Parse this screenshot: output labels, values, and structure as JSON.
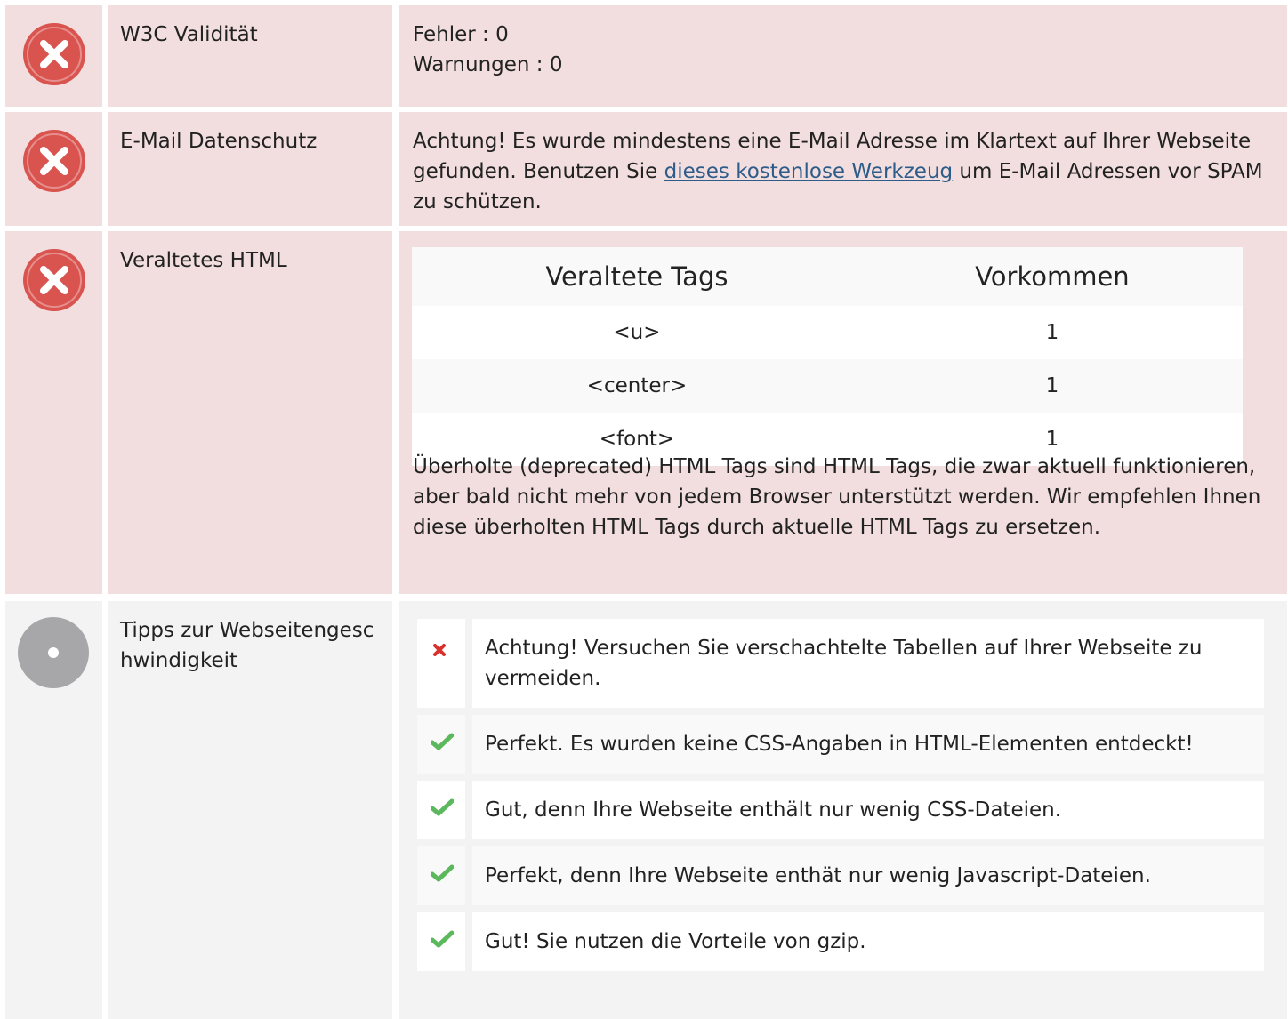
{
  "colors": {
    "error_bg": "#f2dede",
    "neutral_bg": "#f3f3f3",
    "error_icon": "#d9534f",
    "neutral_icon": "#a7a7aa",
    "check_green": "#5cb85c",
    "cross_red": "#d9302c",
    "link": "#2e5c8a"
  },
  "rows": {
    "w3c": {
      "status": "error",
      "icon": "error-circle-icon",
      "label": "W3C Validität",
      "errors": "Fehler : 0",
      "warnings": "Warnungen : 0"
    },
    "email": {
      "status": "error",
      "icon": "error-circle-icon",
      "label": "E-Mail Datenschutz",
      "text_before": "Achtung! Es wurde mindestens eine E-Mail Adresse im Klartext auf Ihrer Webseite gefunden. Benutzen Sie ",
      "link": "dieses kostenlose Werkzeug",
      "text_after": " um E-Mail Adressen vor SPAM zu schützen."
    },
    "deprecated": {
      "status": "error",
      "icon": "error-circle-icon",
      "label": "Veraltetes HTML",
      "headers": [
        "Veraltete Tags",
        "Vorkommen"
      ],
      "tags": [
        {
          "tag": "<u>",
          "count": "1"
        },
        {
          "tag": "<center>",
          "count": "1"
        },
        {
          "tag": "<font>",
          "count": "1"
        }
      ],
      "description": "Überholte (deprecated) HTML Tags sind HTML Tags, die zwar aktuell funktionieren, aber bald nicht mehr von jedem Browser unterstützt werden. Wir empfehlen Ihnen diese überholten HTML Tags durch aktuelle HTML Tags zu ersetzen."
    },
    "speed": {
      "status": "neutral",
      "icon": "neutral-circle-icon",
      "label": "Tipps zur Webseitengeschwindigkeit",
      "tips": [
        {
          "status": "fail",
          "icon": "cross-icon",
          "text": "Achtung! Versuchen Sie verschachtelte Tabellen auf Ihrer Webseite zu vermeiden."
        },
        {
          "status": "pass",
          "icon": "check-icon",
          "text": "Perfekt. Es wurden keine CSS-Angaben in HTML-Elementen entdeckt!"
        },
        {
          "status": "pass",
          "icon": "check-icon",
          "text": "Gut, denn Ihre Webseite enthält nur wenig CSS-Dateien."
        },
        {
          "status": "pass",
          "icon": "check-icon",
          "text": "Perfekt, denn Ihre Webseite enthät nur wenig Javascript-Dateien."
        },
        {
          "status": "pass",
          "icon": "check-icon",
          "text": "Gut! Sie nutzen die Vorteile von gzip."
        }
      ]
    }
  }
}
